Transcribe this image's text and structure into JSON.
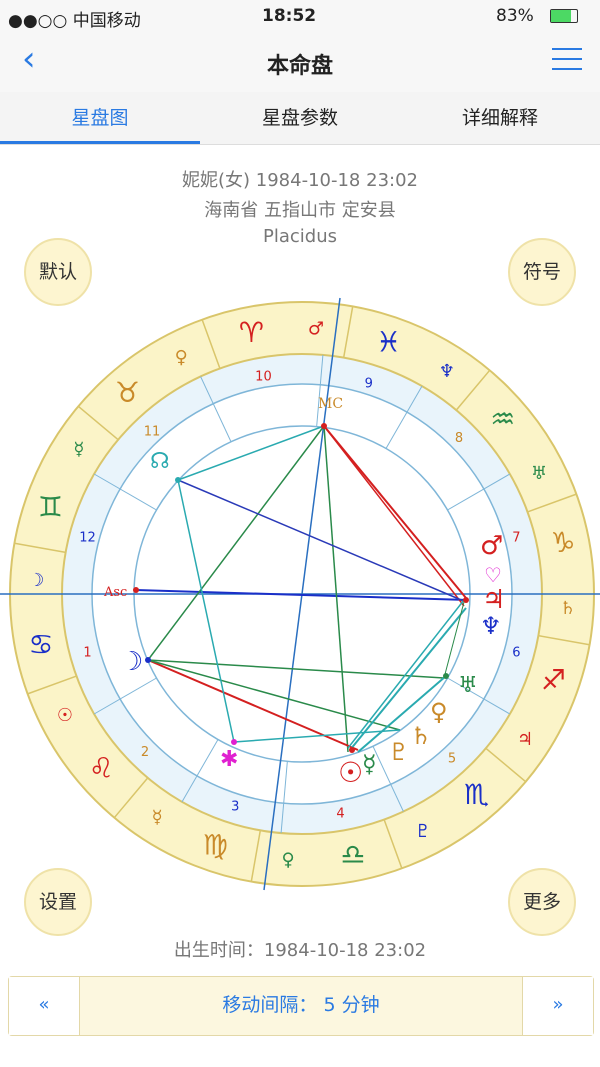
{
  "status": {
    "carrier": "●●○○ 中国移动",
    "time": "18:52",
    "battery": "83%"
  },
  "nav": {
    "title": "本命盘",
    "back_icon": "chevron-left-icon",
    "menu_icon": "hamburger-menu-icon"
  },
  "tabs": [
    {
      "label": "星盘图",
      "active": true
    },
    {
      "label": "星盘参数",
      "active": false
    },
    {
      "label": "详细解释",
      "active": false
    }
  ],
  "info": {
    "line1": "妮妮(女) 1984-10-18 23:02",
    "line2": "海南省 五指山市 定安县",
    "line3": "Placidus"
  },
  "buttons": {
    "default": "默认",
    "symbols": "符号",
    "settings": "设置",
    "more": "更多"
  },
  "chart_labels": {
    "mc": "MC",
    "asc": "Asc",
    "house_numbers": [
      "1",
      "2",
      "3",
      "4",
      "5",
      "6",
      "7",
      "8",
      "9",
      "10",
      "11",
      "12"
    ],
    "signs": [
      "♈",
      "♉",
      "♊",
      "♋",
      "♌",
      "♍",
      "♎",
      "♏",
      "♐",
      "♑",
      "♒",
      "♓"
    ],
    "sign_rulers": [
      "♂",
      "♀",
      "☿",
      "☽",
      "☉",
      "☿",
      "♀",
      "♇",
      "♃",
      "♄",
      "♅",
      "♆"
    ]
  },
  "birth_time": "出生时间：1984-10-18 23:02",
  "bottom": {
    "prev": "«",
    "interval": "移动间隔： 5 分钟",
    "next": "»"
  },
  "colors": {
    "accent": "#2a7ae2",
    "zodiac_ring": "#fbf4c8",
    "house_ring": "#e9f4fb"
  }
}
